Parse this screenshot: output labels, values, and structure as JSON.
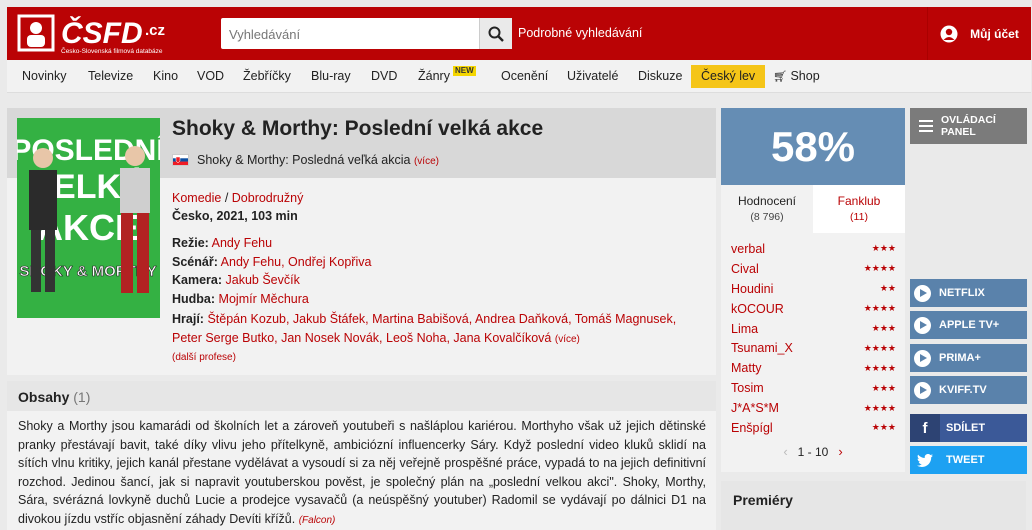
{
  "header": {
    "logo_text": "ČSFD.cz",
    "logo_subtitle": "Česko-Slovenská filmová databáze",
    "search_placeholder": "Vyhledávání",
    "advanced_search": "Podrobné vyhledávání",
    "account": "Můj účet"
  },
  "nav": {
    "items": [
      "Novinky",
      "Televize",
      "Kino",
      "VOD",
      "Žebříčky",
      "Blu-ray",
      "DVD",
      "Žánry",
      "Ocenění",
      "Uživatelé",
      "Diskuze",
      "Český lev",
      "Shop"
    ],
    "new_badge": "NEW"
  },
  "film": {
    "title": "Shoky & Morthy: Poslední velká akce",
    "alt_title": "Shoky & Morthy: Posledná veľká akcia",
    "alt_more": "(více)",
    "genres": [
      "Komedie",
      "Dobrodružný"
    ],
    "genre_sep": " / ",
    "origin": "Česko, 2021, 103 min",
    "director_label": "Režie:",
    "director": "Andy Fehu",
    "writers_label": "Scénář:",
    "writers": "Andy Fehu, Ondřej Kopřiva",
    "camera_label": "Kamera:",
    "camera": "Jakub Ševčík",
    "music_label": "Hudba:",
    "music": "Mojmír Měchura",
    "cast_label": "Hrají:",
    "cast_line1": "Štěpán Kozub, Jakub Štáfek, Martina Babišová, Andrea Daňková, Tomáš Magnusek,",
    "cast_line2": "Peter Serge Butko, Jan Nosek Novák, Leoš Noha, Jana Kovalčíková",
    "cast_more": "(více)",
    "more_professions": "(další profese)",
    "poster": {
      "line1": "POSLEDNÍ",
      "line2": "VELKÁ",
      "line3": "AKCE",
      "line4": "SHOKY & MORTHY"
    }
  },
  "plot": {
    "title": "Obsahy",
    "count": "(1)",
    "text": "Shoky a Morthy jsou kamarádi od školních let a zároveň youtubeři s našláplou kariérou. Morthyho však už jejich dětinské pranky přestávají bavit, také díky vlivu jeho přítelkyně, ambiciózní influencerky Sáry. Když poslední video kluků sklidí na sítích vlnu kritiky, jejich kanál přestane vydělávat a vysoudí si za něj veřejně prospěšné práce, vypadá to na jejich definitivní rozchod. Jedinou šancí, jak si napravit youtuberskou pověst, je společný plán na „poslední velkou akci\". Shoky, Morthy, Sára, svérázná lovkyně duchů Lucie a prodejce vysavačů (a neúspěšný youtuber) Radomil se vydávají po dálnici D1 na divokou jízdu vstříc objasnění záhady Devíti křížů.",
    "author": "(Falcon)"
  },
  "rating": {
    "percent": "58%",
    "tab_ratings": "Hodnocení",
    "tab_ratings_count": "(8 796)",
    "tab_fanclub": "Fanklub",
    "tab_fanclub_count": "(11)",
    "users": [
      {
        "name": "verbal",
        "stars": "★★★"
      },
      {
        "name": "Cival",
        "stars": "★★★★"
      },
      {
        "name": "Houdini",
        "stars": "★★"
      },
      {
        "name": "kOCOUR",
        "stars": "★★★★"
      },
      {
        "name": "Lima",
        "stars": "★★★"
      },
      {
        "name": "Tsunami_X",
        "stars": "★★★★"
      },
      {
        "name": "Matty",
        "stars": "★★★★"
      },
      {
        "name": "Tosim",
        "stars": "★★★"
      },
      {
        "name": "J*A*S*M",
        "stars": "★★★★"
      },
      {
        "name": "Enšpígl",
        "stars": "★★★"
      }
    ],
    "pager": "1 - 10"
  },
  "sidebar": {
    "control_panel": "OVLÁDACÍ PANEL",
    "vod": [
      "NETFLIX",
      "APPLE TV+",
      "PRIMA+",
      "KVIFF.TV"
    ],
    "share_fb": "SDÍLET",
    "share_tw": "TWEET"
  },
  "premiery": "Premiéry",
  "colors": {
    "brand_red": "#ba0305",
    "rating_blue": "#658db4",
    "cesky_lev_yellow": "#f5c518"
  }
}
